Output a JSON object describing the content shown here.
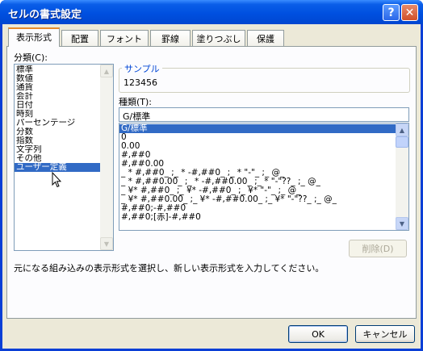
{
  "window": {
    "title": "セルの書式設定",
    "help_glyph": "?",
    "close_glyph": "✕"
  },
  "tabs": [
    {
      "label": "表示形式",
      "active": true
    },
    {
      "label": "配置"
    },
    {
      "label": "フォント"
    },
    {
      "label": "罫線"
    },
    {
      "label": "塗りつぶし"
    },
    {
      "label": "保護"
    }
  ],
  "category": {
    "label": "分類(C):",
    "items": [
      "標準",
      "数値",
      "通貨",
      "会計",
      "日付",
      "時刻",
      "パーセンテージ",
      "分数",
      "指数",
      "文字列",
      "その他",
      "ユーザー定義"
    ],
    "selected": "ユーザー定義"
  },
  "sample": {
    "label": "サンプル",
    "value": "123456"
  },
  "type": {
    "label": "種類(T):",
    "value": "G/標準",
    "items": [
      "G/標準",
      "0",
      "0.00",
      "#,##0",
      "#,##0.00",
      "_ * #,##0_ ;_ * -#,##0_ ;_ * \"-\"_ ;_ @_",
      "_ * #,##0.00_ ;_ * -#,##0.00_ ;_ * \"-\"??_ ;_ @_",
      "_ ¥* #,##0_ ;_ ¥* -#,##0_ ;_ ¥* \"-\"_ ;_ @_",
      "_ ¥* #,##0.00_ ;_ ¥* -#,##0.00_ ;_ ¥* \"-\"??_ ;_ @_",
      "#,##0;-#,##0",
      "#,##0;[赤]-#,##0"
    ],
    "selected": "G/標準"
  },
  "delete_button": "削除(D)",
  "description": "元になる組み込みの表示形式を選択し、新しい表示形式を入力してください。",
  "ok_button": "OK",
  "cancel_button": "キャンセル",
  "scroll_up_glyph": "▲",
  "scroll_down_glyph": "▼",
  "colors": {
    "titlebar": "#0050e0",
    "selection": "#316ac5",
    "tab_accent": "#e68b2c",
    "group_title": "#0046d5"
  },
  "icons": [
    "help-icon",
    "close-icon",
    "scroll-up-icon",
    "scroll-down-icon",
    "mouse-cursor-icon"
  ]
}
